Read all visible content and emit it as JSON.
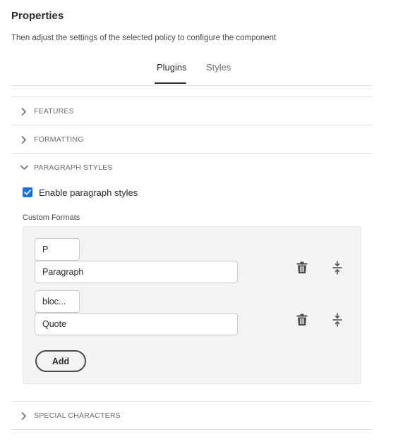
{
  "panel": {
    "title": "Properties",
    "subtitle": "Then adjust the settings of the selected policy to configure the component"
  },
  "tabs": [
    {
      "label": "Plugins",
      "active": true
    },
    {
      "label": "Styles",
      "active": false
    }
  ],
  "sections": {
    "features": {
      "label": "FEATURES",
      "expanded": false
    },
    "formatting": {
      "label": "FORMATTING",
      "expanded": false
    },
    "paragraph_styles": {
      "label": "PARAGRAPH STYLES",
      "expanded": true
    },
    "special_characters": {
      "label": "SPECIAL CHARACTERS",
      "expanded": false
    }
  },
  "paragraph_styles": {
    "enable_label": "Enable paragraph styles",
    "enabled": true,
    "custom_formats_label": "Custom Formats",
    "formats": [
      {
        "tag": "P",
        "description": "Paragraph"
      },
      {
        "tag": "bloc...",
        "description": "Quote"
      }
    ],
    "add_label": "Add"
  },
  "icons": {
    "collapsed": "chevron-right-icon",
    "expanded": "chevron-down-icon",
    "delete": "trash-icon",
    "reorder": "drag-handle-icon",
    "check": "checkmark-icon"
  },
  "colors": {
    "accent": "#1473e6",
    "text": "#2c2c2c",
    "muted": "#6e6e6e",
    "divider": "#e1e1e1",
    "panel_bg": "#f4f4f4"
  }
}
